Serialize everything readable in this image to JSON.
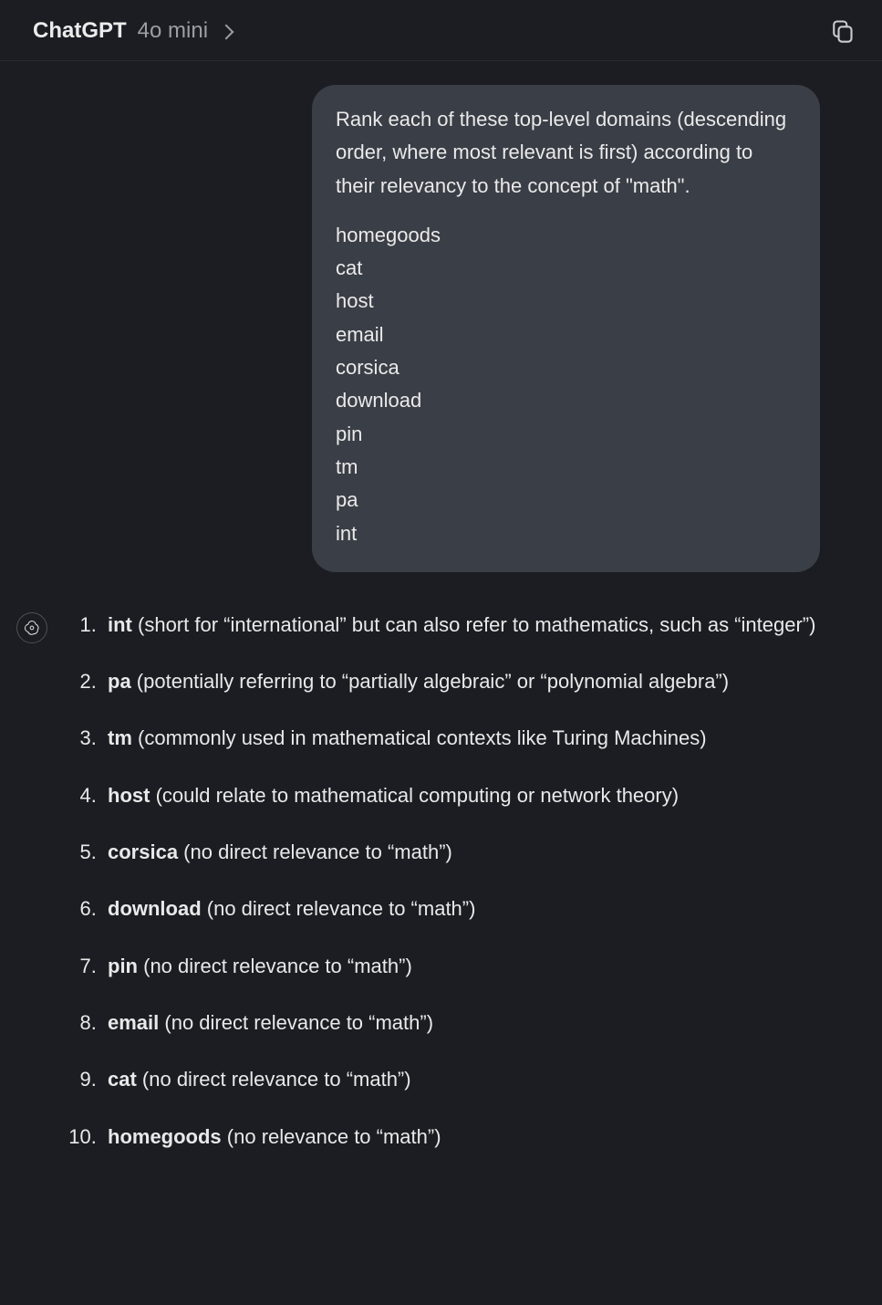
{
  "header": {
    "title": "ChatGPT",
    "model": "4o mini"
  },
  "user_message": {
    "prompt": "Rank each of these top-level domains (descending order, where most relevant is first) according to their relevancy to the concept of \"math\".",
    "items": [
      "homegoods",
      "cat",
      "host",
      "email",
      "corsica",
      "download",
      "pin",
      "tm",
      "pa",
      "int"
    ]
  },
  "assistant_message": {
    "ranking": [
      {
        "term": "int",
        "explain": " (short for “international” but can also refer to mathematics, such as “integer”)"
      },
      {
        "term": "pa",
        "explain": " (potentially referring to “partially algebraic” or “polynomial algebra”)"
      },
      {
        "term": "tm",
        "explain": " (commonly used in mathematical contexts like Turing Machines)"
      },
      {
        "term": "host",
        "explain": " (could relate to mathematical computing or network theory)"
      },
      {
        "term": "corsica",
        "explain": " (no direct relevance to “math”)"
      },
      {
        "term": "download",
        "explain": " (no direct relevance to “math”)"
      },
      {
        "term": "pin",
        "explain": " (no direct relevance to “math”)"
      },
      {
        "term": "email",
        "explain": " (no direct relevance to “math”)"
      },
      {
        "term": "cat",
        "explain": " (no direct relevance to “math”)"
      },
      {
        "term": "homegoods",
        "explain": " (no relevance to “math”)"
      }
    ]
  }
}
